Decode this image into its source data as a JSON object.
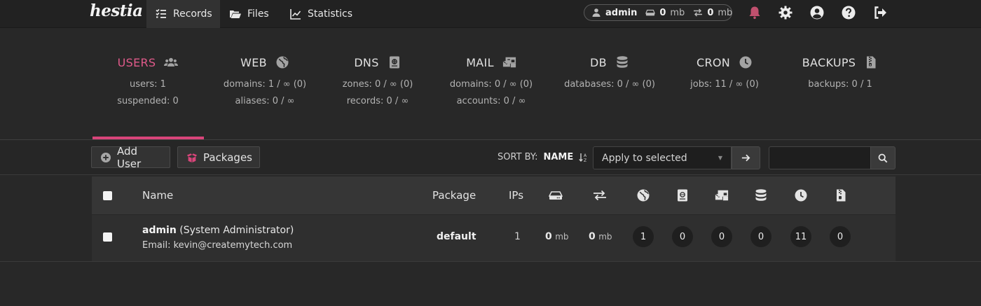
{
  "topbar": {
    "logo_text": "hestia",
    "tabs": [
      {
        "label": "Records",
        "icon": "list-check-icon",
        "active": true
      },
      {
        "label": "Files",
        "icon": "folder-icon",
        "active": false
      },
      {
        "label": "Statistics",
        "icon": "chart-line-icon",
        "active": false
      }
    ],
    "user_pill": {
      "username": "admin",
      "disk_value": "0",
      "disk_unit": "mb",
      "bandwidth_value": "0",
      "bandwidth_unit": "mb"
    },
    "right_icons": [
      "bell-icon",
      "gear-icon",
      "user-circle-icon",
      "question-icon",
      "logout-icon"
    ],
    "colors": {
      "bell": "#c0506e",
      "accent": "#d8457a"
    }
  },
  "stats": [
    {
      "title": "USERS",
      "icon": "users-icon",
      "active": true,
      "lines": [
        "users: 1",
        "suspended: 0"
      ]
    },
    {
      "title": "WEB",
      "icon": "globe-icon",
      "active": false,
      "lines": [
        "domains: 1 / ∞ (0)",
        "aliases: 0 / ∞"
      ]
    },
    {
      "title": "DNS",
      "icon": "address-book-icon",
      "active": false,
      "lines": [
        "zones: 0 / ∞ (0)",
        "records: 0 / ∞"
      ]
    },
    {
      "title": "MAIL",
      "icon": "mail-bulk-icon",
      "active": false,
      "lines": [
        "domains: 0 / ∞ (0)",
        "accounts: 0 / ∞"
      ]
    },
    {
      "title": "DB",
      "icon": "database-icon",
      "active": false,
      "lines": [
        "databases: 0 / ∞ (0)",
        ""
      ]
    },
    {
      "title": "CRON",
      "icon": "clock-icon",
      "active": false,
      "lines": [
        "jobs: 11 / ∞ (0)",
        ""
      ]
    },
    {
      "title": "BACKUPS",
      "icon": "file-zipper-icon",
      "active": false,
      "lines": [
        "backups: 0 / 1",
        ""
      ]
    }
  ],
  "toolbar": {
    "add_user_label": "Add User",
    "packages_label": "Packages",
    "sort_by_label": "SORT BY:",
    "sort_field": "NAME",
    "bulk_select_value": "Apply to selected",
    "search_placeholder": ""
  },
  "table": {
    "headers": {
      "name": "Name",
      "package": "Package",
      "ips": "IPs"
    },
    "icon_headers": [
      "hdd-icon",
      "exchange-icon",
      "globe-icon",
      "address-book-icon",
      "mail-bulk-icon",
      "database-icon",
      "clock-icon",
      "file-zipper-icon"
    ],
    "rows": [
      {
        "username": "admin",
        "fullname": "(System Administrator)",
        "email_label": "Email:",
        "email": "kevin@createmytech.com",
        "package": "default",
        "ips": "1",
        "disk_value": "0",
        "disk_unit": "mb",
        "bandwidth_value": "0",
        "bandwidth_unit": "mb",
        "web": "1",
        "dns": "0",
        "mail": "0",
        "db": "0",
        "cron": "11",
        "backups": "0"
      }
    ]
  }
}
